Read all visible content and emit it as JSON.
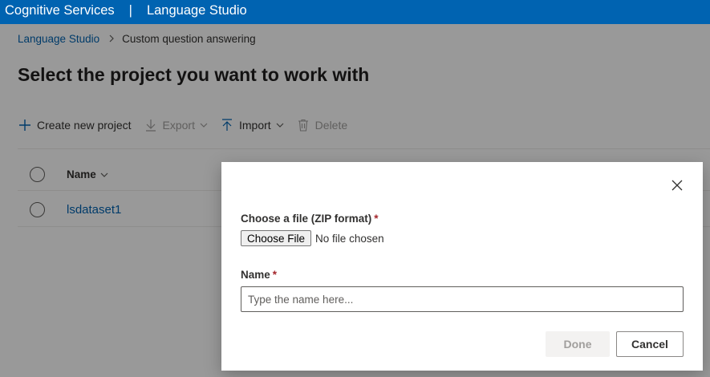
{
  "topbar": {
    "brand": "Cognitive Services",
    "separator": "|",
    "product": "Language Studio"
  },
  "breadcrumb": {
    "root": "Language Studio",
    "current": "Custom question answering"
  },
  "page": {
    "title": "Select the project you want to work with"
  },
  "toolbar": {
    "create_label": "Create new project",
    "export_label": "Export",
    "import_label": "Import",
    "delete_label": "Delete"
  },
  "table": {
    "columns": [
      "Name"
    ],
    "rows": [
      {
        "name": "lsdataset1"
      }
    ]
  },
  "dialog": {
    "file_label": "Choose a file (ZIP format)",
    "required_mark": "*",
    "choose_file_button": "Choose File",
    "file_status": "No file chosen",
    "name_label": "Name",
    "name_placeholder": "Type the name here...",
    "done_button": "Done",
    "cancel_button": "Cancel"
  },
  "colors": {
    "topbar": "#0063b1",
    "link": "#0063b1",
    "required": "#a4262c",
    "disabled_text": "#a19f9d"
  }
}
